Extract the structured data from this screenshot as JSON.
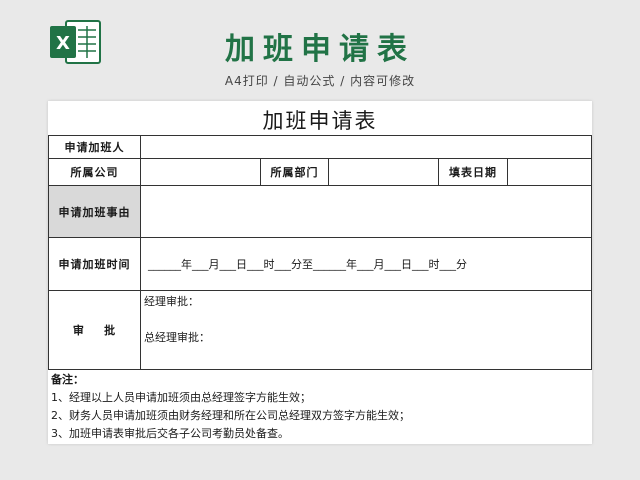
{
  "header": {
    "title": "加班申请表",
    "subtitle": "A4打印 / 自动公式 / 内容可修改",
    "logo_letter": "X",
    "brand_color": "#217346"
  },
  "form": {
    "title": "加班申请表",
    "applicant_label": "申请加班人",
    "company_label": "所属公司",
    "department_label": "所属部门",
    "date_label": "填表日期",
    "reason_label": "申请加班事由",
    "time_label": "申请加班时间",
    "time_value": "______年___月___日___时___分至______年___月___日___时___分",
    "approval_label": "审    批",
    "manager_approval": "经理审批：",
    "general_manager_approval": "总经理审批："
  },
  "notes": {
    "heading": "备注：",
    "items": [
      "1、经理以上人员申请加班须由总经理签字方能生效；",
      "2、财务人员申请加班须由财务经理和所在公司总经理双方签字方能生效；",
      "3、加班申请表审批后交各子公司考勤员处备查。"
    ]
  }
}
